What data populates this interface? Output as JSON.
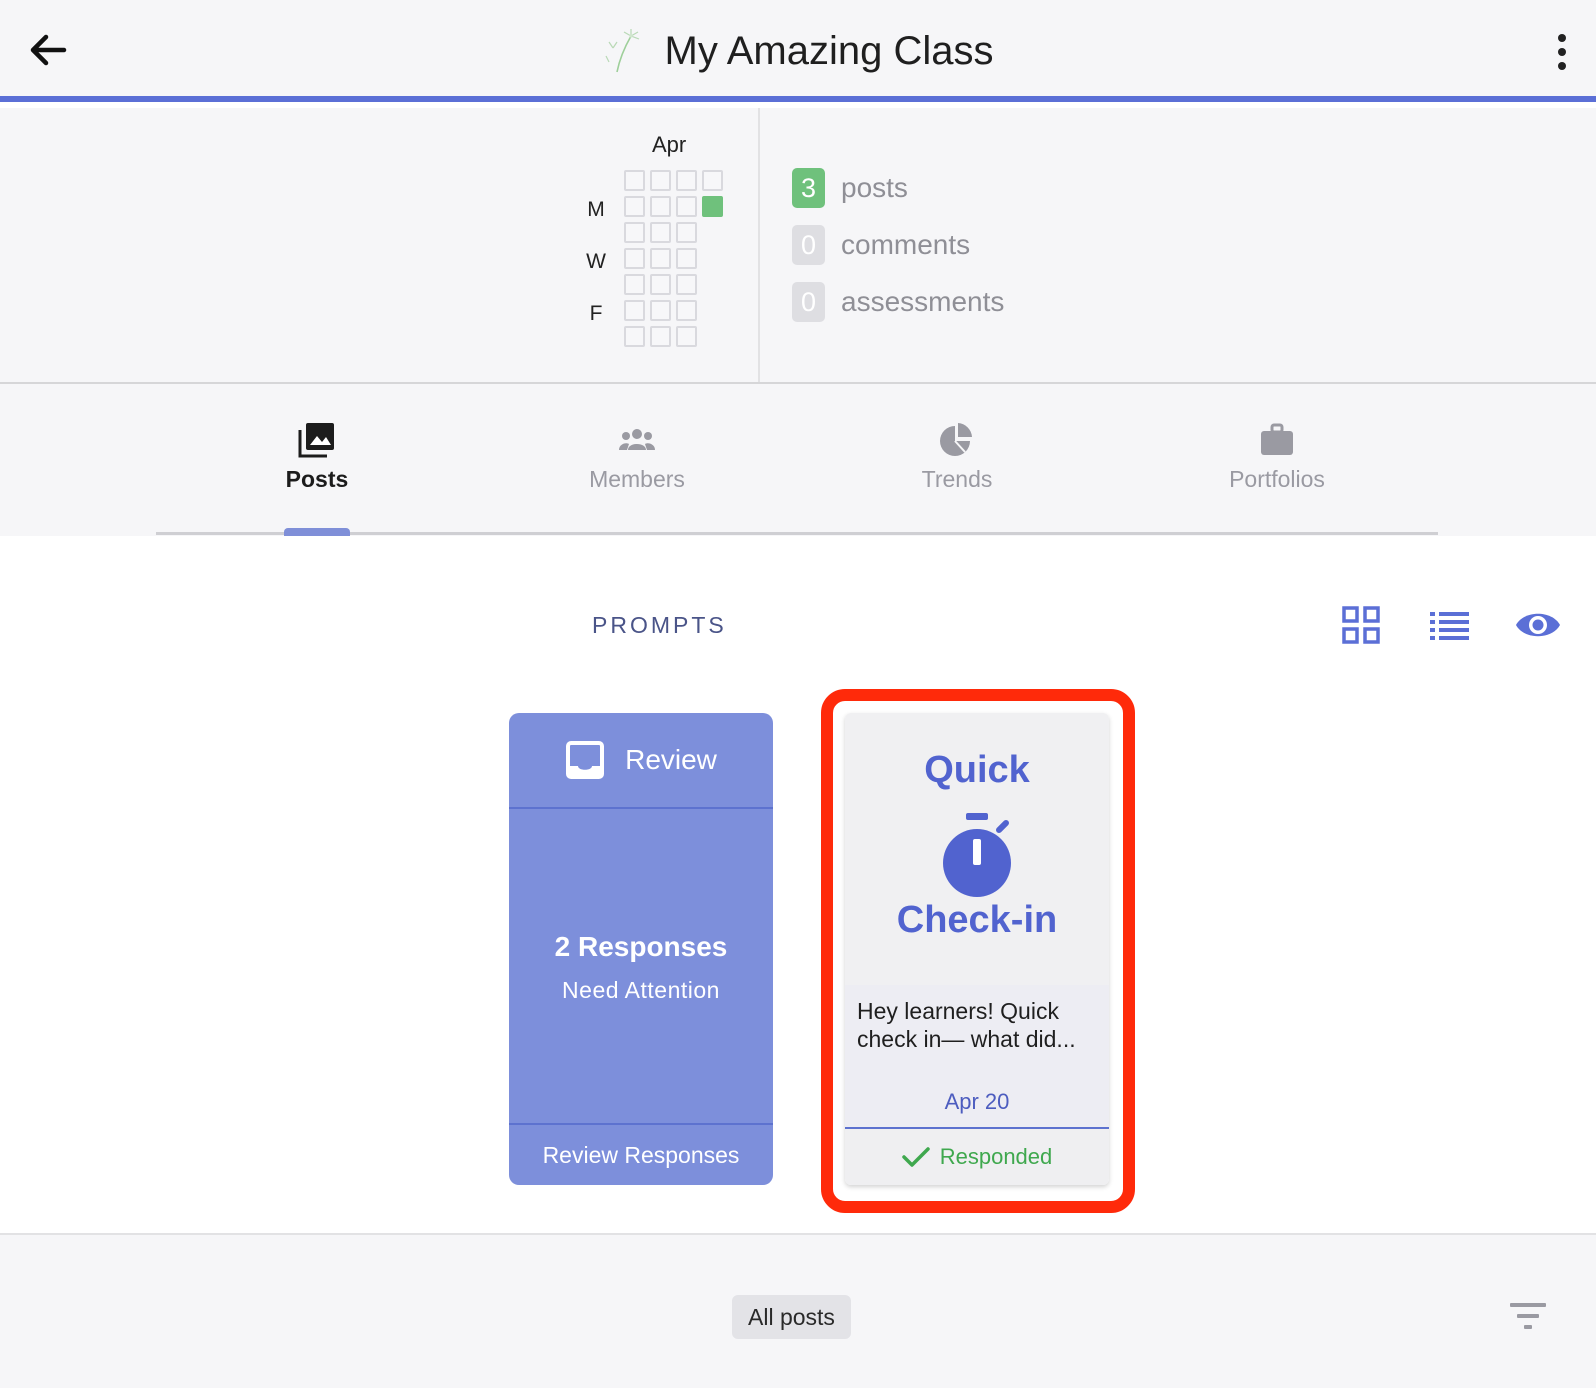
{
  "header": {
    "title": "My Amazing Class",
    "icons": {
      "back": "arrow-left-icon",
      "logo": "dandelion-logo",
      "more": "more-vertical-icon"
    }
  },
  "summary": {
    "month": "Apr",
    "days": [
      "M",
      "W",
      "F"
    ],
    "stats": [
      {
        "count": "3",
        "label": "posts"
      },
      {
        "count": "0",
        "label": "comments"
      },
      {
        "count": "0",
        "label": "assessments"
      }
    ],
    "colors": {
      "active_day": "#6fc17c",
      "accent": "#5b6fd6"
    }
  },
  "tabs": [
    {
      "label": "Posts",
      "icon": "photo-library-icon",
      "active": true
    },
    {
      "label": "Members",
      "icon": "group-icon",
      "active": false
    },
    {
      "label": "Trends",
      "icon": "pie-chart-icon",
      "active": false
    },
    {
      "label": "Portfolios",
      "icon": "briefcase-icon",
      "active": false
    }
  ],
  "prompts": {
    "heading": "PROMPTS",
    "view_icons": [
      "grid-view-icon",
      "list-view-icon",
      "eye-icon"
    ],
    "review_card": {
      "title": "Review",
      "count": "2 Responses",
      "subtitle": "Need Attention",
      "footer": "Review Responses"
    },
    "prompt_card": {
      "word_top": "Quick",
      "word_bottom": "Check-in",
      "text": "Hey learners! Quick check in— what did...",
      "date": "Apr 20",
      "status": "Responded"
    }
  },
  "bottom": {
    "filter_label": "All posts",
    "filter_icon": "filter-list-icon"
  }
}
